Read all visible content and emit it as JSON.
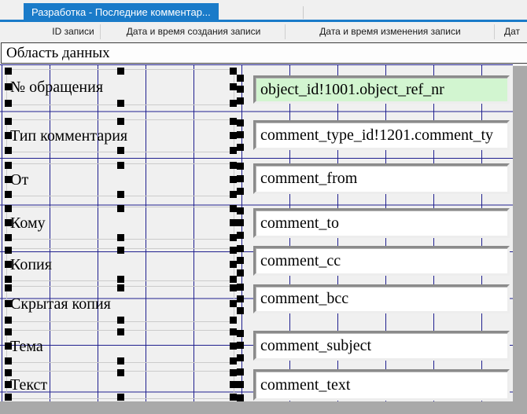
{
  "tab": {
    "title": "Разработка - Последние комментар..."
  },
  "grid_header": {
    "columns": [
      {
        "label": "ID записи"
      },
      {
        "label": "Дата и время создания записи"
      },
      {
        "label": "Дата и время изменения записи"
      },
      {
        "label": "Дат"
      }
    ]
  },
  "band": {
    "title": "Область данных"
  },
  "form": {
    "rows": [
      {
        "label": "№ обращения",
        "value": "object_id!1001.object_ref_nr",
        "highlight": true
      },
      {
        "label": "Тип комментария",
        "value": "comment_type_id!1201.comment_ty",
        "highlight": false
      },
      {
        "label": "От",
        "value": "comment_from",
        "highlight": false
      },
      {
        "label": "Кому",
        "value": "comment_to",
        "highlight": false
      },
      {
        "label": "Копия",
        "value": "comment_cc",
        "highlight": false
      },
      {
        "label": "Скрытая копия",
        "value": "comment_bcc",
        "highlight": false
      },
      {
        "label": "Тема",
        "value": "comment_subject",
        "highlight": false
      },
      {
        "label": "Текст",
        "value": "comment_text",
        "highlight": false
      }
    ]
  },
  "colors": {
    "accent_blue": "#1a7bc9",
    "grid_line": "#20208f",
    "highlight_green": "#d2f5d0",
    "outside_gray": "#a9a9a9"
  }
}
